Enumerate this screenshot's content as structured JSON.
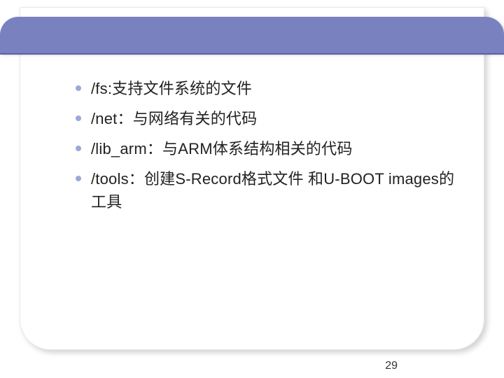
{
  "bullets": {
    "items": [
      "/fs:支持文件系统的文件",
      "/net：与网络有关的代码",
      "/lib_arm：与ARM体系结构相关的代码",
      "/tools：创建S-Record格式文件 和U-BOOT images的工具"
    ]
  },
  "page_number": "29",
  "accent_color": "#7a81bf"
}
